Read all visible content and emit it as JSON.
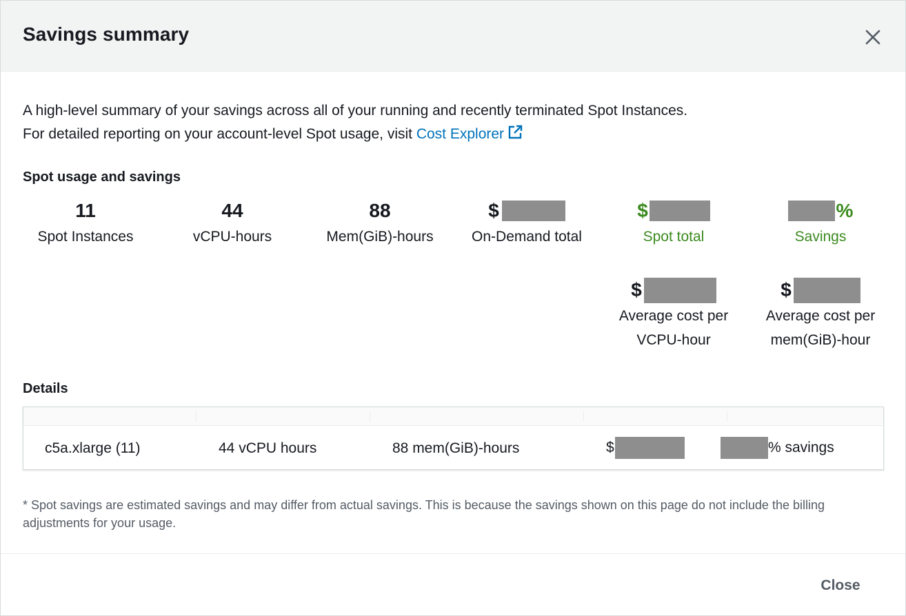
{
  "modal": {
    "title": "Savings summary",
    "close_icon": "close-icon"
  },
  "intro": {
    "line1": "A high-level summary of your savings across all of your running and recently terminated Spot Instances.",
    "line2_prefix": "For detailed reporting on your account-level Spot usage, visit ",
    "link_label": "Cost Explorer",
    "link_icon": "external-link-icon"
  },
  "usage": {
    "section_title": "Spot usage and savings",
    "spot_instances": {
      "value": "11",
      "label": "Spot Instances"
    },
    "vcpu_hours": {
      "value": "44",
      "label": "vCPU-hours"
    },
    "mem_hours": {
      "value": "88",
      "label": "Mem(GiB)-hours"
    },
    "on_demand_total": {
      "prefix": "$",
      "label": "On-Demand total"
    },
    "spot_total": {
      "prefix": "$",
      "label": "Spot total"
    },
    "savings": {
      "suffix": "%",
      "label": "Savings"
    },
    "avg_vcpu": {
      "prefix": "$",
      "label_line1": "Average cost per",
      "label_line2": "VCPU-hour"
    },
    "avg_mem": {
      "prefix": "$",
      "label_line1": "Average cost per",
      "label_line2": "mem(GiB)-hour"
    }
  },
  "details": {
    "section_title": "Details",
    "row": {
      "instance": "c5a.xlarge (11)",
      "vcpu": "44 vCPU hours",
      "mem": "88 mem(GiB)-hours",
      "cost_prefix": "$",
      "savings_suffix": "% savings"
    }
  },
  "footnote": "* Spot savings are estimated savings and may differ from actual savings. This is because the savings shown on this page do not include the billing adjustments for your usage.",
  "footer": {
    "close_label": "Close"
  },
  "colors": {
    "accent_link": "#0073bb",
    "savings_green": "#3b8a1f",
    "redaction": "#8e8e8e"
  }
}
